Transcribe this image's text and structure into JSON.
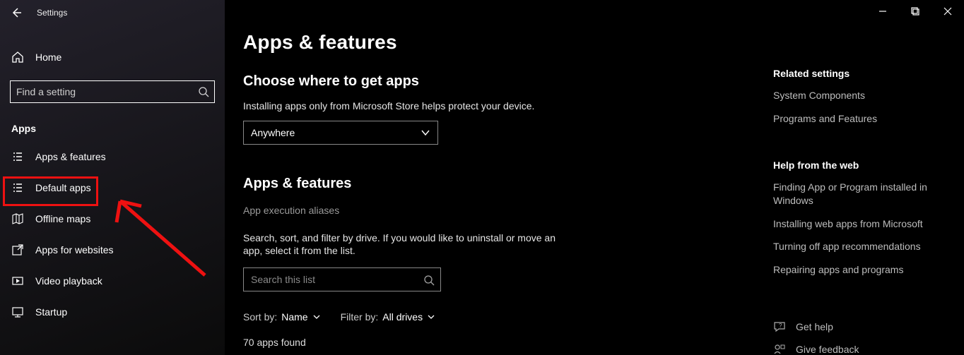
{
  "window": {
    "title": "Settings"
  },
  "sidebar": {
    "home_label": "Home",
    "search_placeholder": "Find a setting",
    "section_head": "Apps",
    "items": [
      {
        "label": "Apps & features"
      },
      {
        "label": "Default apps"
      },
      {
        "label": "Offline maps"
      },
      {
        "label": "Apps for websites"
      },
      {
        "label": "Video playback"
      },
      {
        "label": "Startup"
      }
    ]
  },
  "main": {
    "page_title": "Apps & features",
    "choose_title": "Choose where to get apps",
    "choose_body": "Installing apps only from Microsoft Store helps protect your device.",
    "source_value": "Anywhere",
    "af_title": "Apps & features",
    "aliases_link": "App execution aliases",
    "list_body": "Search, sort, and filter by drive. If you would like to uninstall or move an app, select it from the list.",
    "list_search_placeholder": "Search this list",
    "sort_label": "Sort by:",
    "sort_value": "Name",
    "filter_label": "Filter by:",
    "filter_value": "All drives",
    "found_text": "70 apps found"
  },
  "rail": {
    "related_head": "Related settings",
    "related_links": [
      "System Components",
      "Programs and Features"
    ],
    "help_head": "Help from the web",
    "help_links": [
      "Finding App or Program installed in Windows",
      "Installing web apps from Microsoft",
      "Turning off app recommendations",
      "Repairing apps and programs"
    ],
    "get_help": "Get help",
    "feedback": "Give feedback"
  },
  "annotation": {
    "highlighted_item": "Default apps"
  }
}
